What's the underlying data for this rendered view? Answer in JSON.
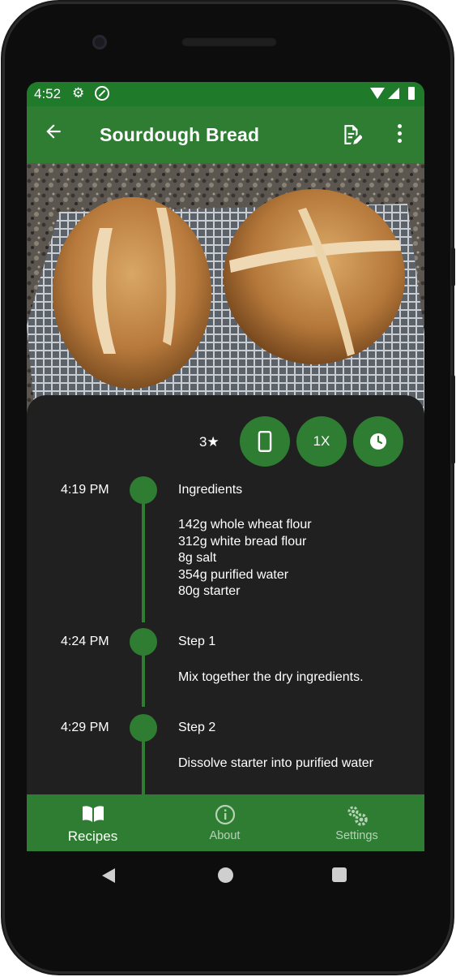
{
  "status_bar": {
    "time": "4:52"
  },
  "app_bar": {
    "title": "Sourdough Bread"
  },
  "header_image": {
    "description_icon": "bread-photo"
  },
  "recipe_actions": {
    "rating": "3★",
    "scale_label": "1X"
  },
  "timeline": [
    {
      "time": "4:19 PM",
      "title": "Ingredients",
      "lines": [
        "142g whole wheat flour",
        "312g white bread flour",
        "8g salt",
        "354g purified water",
        "80g starter"
      ]
    },
    {
      "time": "4:24 PM",
      "title": "Step 1",
      "lines": [
        "Mix together the dry ingredients."
      ]
    },
    {
      "time": "4:29 PM",
      "title": "Step 2",
      "lines": [
        "Dissolve starter into purified water"
      ]
    }
  ],
  "bottom_nav": {
    "items": [
      {
        "label": "Recipes",
        "icon": "book-icon",
        "active": true
      },
      {
        "label": "About",
        "icon": "info-icon",
        "active": false
      },
      {
        "label": "Settings",
        "icon": "gears-icon",
        "active": false
      }
    ]
  },
  "colors": {
    "primary": "#2e7d32",
    "status_bar": "#1f7a2a",
    "background": "#202020"
  }
}
